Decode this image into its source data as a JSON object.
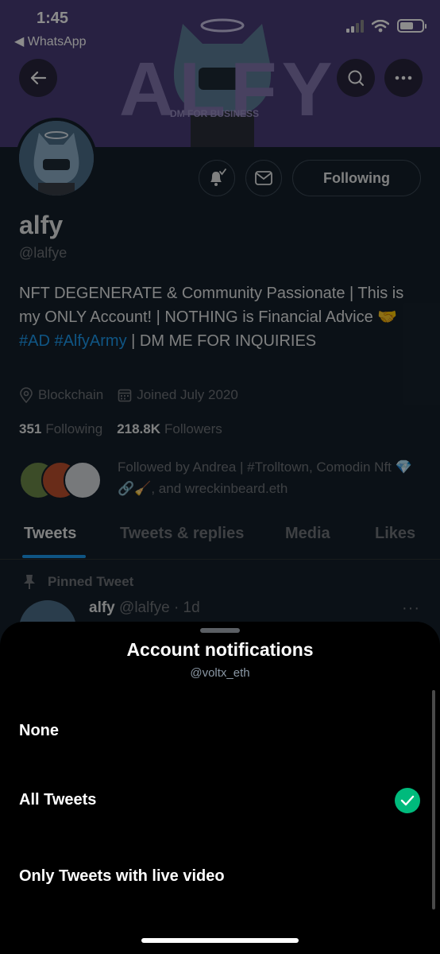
{
  "status_bar": {
    "time": "1:45",
    "back_app": "◀ WhatsApp"
  },
  "banner": {
    "title": "ALFY",
    "subtitle": "DM FOR BUSINESS"
  },
  "profile": {
    "name": "alfy",
    "handle": "@lalfye",
    "following_button": "Following",
    "bio": {
      "part1": "NFT DEGENERATE & Community Passionate | This is my ONLY Account! | NOTHING is Financial Advice 🤝 ",
      "tag1": "#AD",
      "tag2": "#AlfyArmy",
      "part2": " | DM ME FOR INQUIRIES"
    },
    "location": "Blockchain",
    "joined": "Joined July 2020",
    "following_count": "351",
    "following_label": "Following",
    "followers_count": "218.8K",
    "followers_label": "Followers",
    "followed_by": "Followed by Andrea | #Trolltown, Comodin Nft 💎🔗🧹, and wreckinbeard.eth"
  },
  "tabs": [
    {
      "label": "Tweets"
    },
    {
      "label": "Tweets & replies"
    },
    {
      "label": "Media"
    },
    {
      "label": "Likes"
    }
  ],
  "pinned_tweet": {
    "label": "Pinned Tweet",
    "author": "alfy",
    "meta": "@lalfye · 1d",
    "more": "···"
  },
  "sheet": {
    "title": "Account notifications",
    "subtitle": "@voltx_eth",
    "options": [
      {
        "label": "None",
        "selected": false
      },
      {
        "label": "All Tweets",
        "selected": true
      },
      {
        "label": "Only Tweets with live video",
        "selected": false
      }
    ]
  },
  "colors": {
    "accent": "#1d9bf0",
    "check": "#00ba7c",
    "banner": "#4a3d78"
  }
}
